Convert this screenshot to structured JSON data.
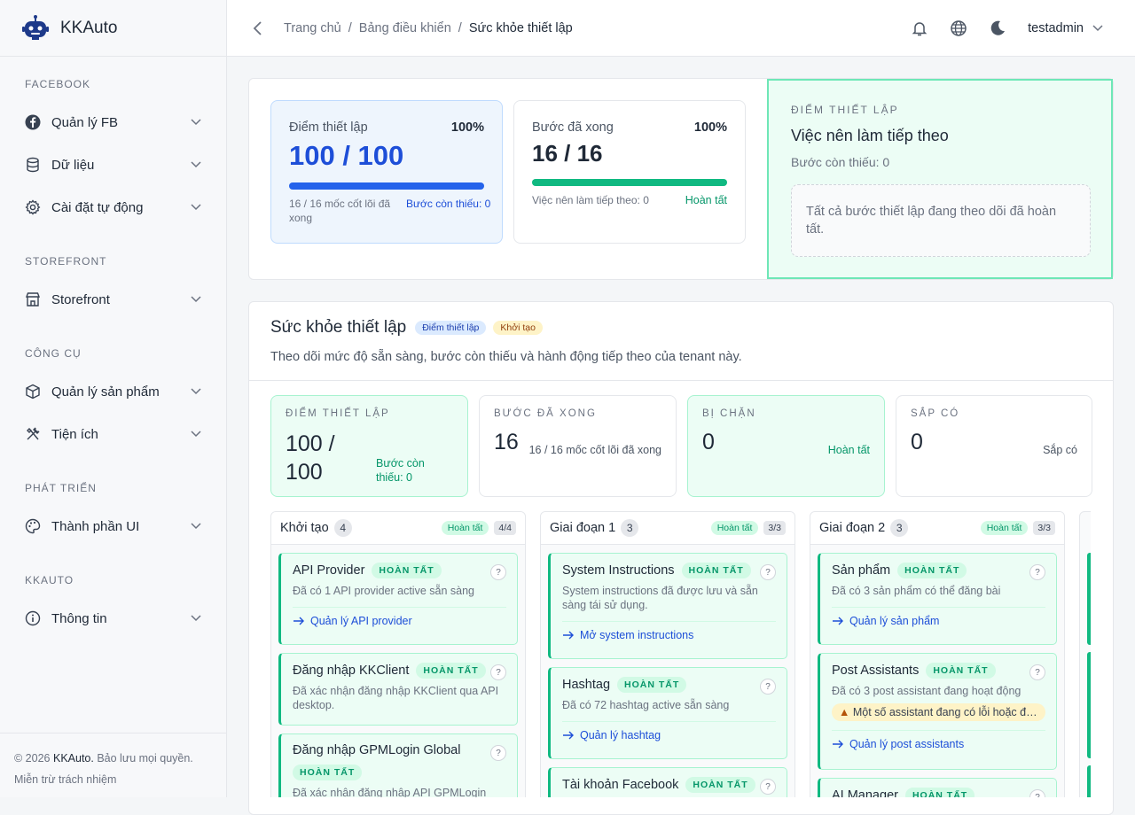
{
  "app": {
    "name": "KKAuto"
  },
  "sidebar": {
    "sections": [
      {
        "title": "FACEBOOK",
        "items": [
          {
            "label": "Quản lý FB",
            "icon": "facebook-icon"
          },
          {
            "label": "Dữ liệu",
            "icon": "database-icon"
          },
          {
            "label": "Cài đặt tự động",
            "icon": "gear-icon"
          }
        ]
      },
      {
        "title": "STOREFRONT",
        "items": [
          {
            "label": "Storefront",
            "icon": "store-icon"
          }
        ]
      },
      {
        "title": "CÔNG CỤ",
        "items": [
          {
            "label": "Quản lý sản phẩm",
            "icon": "box-icon"
          },
          {
            "label": "Tiện ích",
            "icon": "tools-icon"
          }
        ]
      },
      {
        "title": "PHÁT TRIỂN",
        "items": [
          {
            "label": "Thành phần UI",
            "icon": "palette-icon"
          }
        ]
      },
      {
        "title": "KKAUTO",
        "items": [
          {
            "label": "Thông tin",
            "icon": "info-icon"
          }
        ]
      }
    ],
    "footer": {
      "copyright_prefix": "© 2026",
      "brand": "KKAuto.",
      "rights": "Bảo lưu mọi quyền.",
      "disclaimer": "Miễn trừ trách nhiệm"
    }
  },
  "topbar": {
    "breadcrumb": [
      "Trang chủ",
      "Bảng điều khiển",
      "Sức khỏe thiết lập"
    ],
    "user": "testadmin"
  },
  "summary": {
    "score": {
      "label": "Điểm thiết lập",
      "percent": "100%",
      "value": "100 / 100",
      "progress": 1.0,
      "note": "16 / 16 mốc cốt lõi đã xong",
      "missing": "Bước còn thiếu: 0"
    },
    "steps": {
      "label": "Bước đã xong",
      "percent": "100%",
      "value": "16 / 16",
      "progress": 1.0,
      "next": "Việc nên làm tiếp theo: 0",
      "status": "Hoàn tất"
    },
    "next": {
      "eyebrow": "ĐIỂM THIẾT LẬP",
      "title": "Việc nên làm tiếp theo",
      "missing": "Bước còn thiếu: 0",
      "empty": "Tất cả bước thiết lập đang theo dõi đã hoàn tất."
    }
  },
  "health": {
    "title": "Sức khỏe thiết lập",
    "badge1": "Điểm thiết lập",
    "badge2": "Khởi tạo",
    "subtitle": "Theo dõi mức độ sẵn sàng, bước còn thiếu và hành động tiếp theo của tenant này.",
    "stats": [
      {
        "label": "ĐIỂM THIẾT LẬP",
        "value1": "100 /",
        "value2": "100",
        "side": "Bước còn thiếu: 0"
      },
      {
        "label": "BƯỚC ĐÃ XONG",
        "value": "16",
        "side": "16 / 16 mốc cốt lõi đã xong"
      },
      {
        "label": "BỊ CHẶN",
        "value": "0",
        "side": "Hoàn tất"
      },
      {
        "label": "SẮP CÓ",
        "value": "0",
        "side": "Sắp có"
      }
    ],
    "columns": [
      {
        "title": "Khởi tạo",
        "count": "4",
        "status": "Hoàn tất",
        "frac": "4/4",
        "tasks": [
          {
            "title": "API Provider",
            "tag": "HOÀN TẤT",
            "desc": "Đã có 1 API provider active sẵn sàng",
            "link": "Quản lý API provider"
          },
          {
            "title": "Đăng nhập KKClient",
            "tag": "HOÀN TẤT",
            "desc": "Đã xác nhận đăng nhập KKClient qua API desktop."
          },
          {
            "title": "Đăng nhập GPMLogin Global",
            "tag": "HOÀN TẤT",
            "desc": "Đã xác nhận đăng nhập API GPMLogin"
          }
        ]
      },
      {
        "title": "Giai đoạn 1",
        "count": "3",
        "status": "Hoàn tất",
        "frac": "3/3",
        "tasks": [
          {
            "title": "System Instructions",
            "tag": "HOÀN TẤT",
            "desc": "System instructions đã được lưu và sẵn sàng tái sử dụng.",
            "link": "Mở system instructions"
          },
          {
            "title": "Hashtag",
            "tag": "HOÀN TẤT",
            "desc": "Đã có 72 hashtag active sẵn sàng",
            "link": "Quản lý hashtag"
          },
          {
            "title": "Tài khoản Facebook",
            "tag": "HOÀN TẤT"
          }
        ]
      },
      {
        "title": "Giai đoạn 2",
        "count": "3",
        "status": "Hoàn tất",
        "frac": "3/3",
        "tasks": [
          {
            "title": "Sản phẩm",
            "tag": "HOÀN TẤT",
            "desc": "Đã có 3 sản phẩm có thể đăng bài",
            "link": "Quản lý sản phẩm"
          },
          {
            "title": "Post Assistants",
            "tag": "HOÀN TẤT",
            "desc": "Đã có 3 post assistant đang hoạt động",
            "warn": "Một số assistant đang có lỗi hoặc đang chờ",
            "link": "Quản lý post assistants"
          },
          {
            "title": "AI Manager",
            "tag": "HOÀN TẤT"
          }
        ]
      }
    ]
  }
}
